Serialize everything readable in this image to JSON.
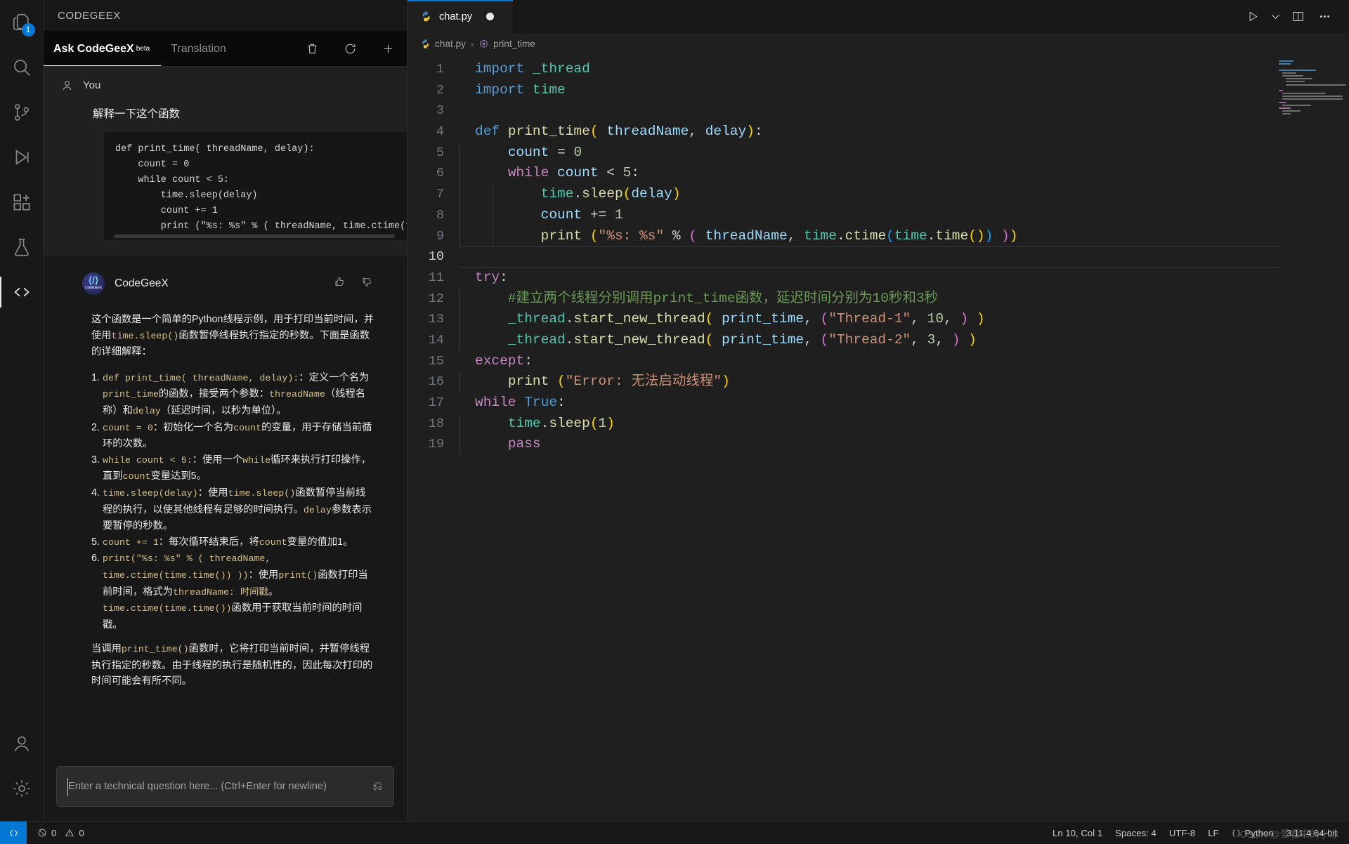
{
  "activitybar": {
    "items": [
      {
        "name": "explorer",
        "icon": "files-icon",
        "badge": "1",
        "active": false
      },
      {
        "name": "search",
        "icon": "search-icon",
        "badge": "",
        "active": false
      },
      {
        "name": "source-control",
        "icon": "source-control-icon",
        "badge": "",
        "active": false
      },
      {
        "name": "run-debug",
        "icon": "run-debug-icon",
        "badge": "",
        "active": false
      },
      {
        "name": "extensions",
        "icon": "extensions-icon",
        "badge": "",
        "active": false
      },
      {
        "name": "testing",
        "icon": "beaker-icon",
        "badge": "",
        "active": false
      },
      {
        "name": "codegeex",
        "icon": "code-brackets-icon",
        "badge": "",
        "active": true
      }
    ],
    "bottom": [
      {
        "name": "accounts",
        "icon": "account-icon"
      },
      {
        "name": "settings",
        "icon": "gear-icon"
      }
    ]
  },
  "sidepanel": {
    "title": "CODEGEEX",
    "tabs": [
      {
        "label": "Ask CodeGeeX",
        "sup": "beta",
        "active": true
      },
      {
        "label": "Translation",
        "sup": "",
        "active": false
      }
    ],
    "actions": [
      {
        "name": "clear-chat-button",
        "icon": "trash-icon"
      },
      {
        "name": "history-button",
        "icon": "history-icon"
      },
      {
        "name": "new-chat-button",
        "icon": "plus-icon"
      }
    ],
    "user_message": {
      "author": "You",
      "text": "解释一下这个函数",
      "code": "def print_time( threadName, delay):\n    count = 0\n    while count < 5:\n        time.sleep(delay)\n        count += 1\n        print (\"%s: %s\" % ( threadName, time.ctime(time.t"
    },
    "bot_message": {
      "author": "CodeGeeX",
      "intro_a": "这个函数是一个简单的Python线程示例，用于打印当前时间，并使用",
      "intro_code": "time.sleep()",
      "intro_b": "函数暂停线程执行指定的秒数。下面是函数的详细解释：",
      "items": [
        {
          "code": "def print_time( threadName, delay):",
          "text_a": "：定义一个名为",
          "code_b": "print_time",
          "text_b": "的函数，接受两个参数：",
          "code_c": "threadName",
          "text_c": "（线程名称）和",
          "code_d": "delay",
          "text_d": "（延迟时间，以秒为单位）。"
        },
        {
          "code": "count = 0",
          "text_a": "：初始化一个名为",
          "code_b": "count",
          "text_b": "的变量，用于存储当前循环的次数。"
        },
        {
          "code": "while count < 5:",
          "text_a": "：使用一个",
          "code_b": "while",
          "text_b": "循环来执行打印操作，直到",
          "code_c": "count",
          "text_c": "变量达到5。"
        },
        {
          "code": "time.sleep(delay)",
          "text_a": "：使用",
          "code_b": "time.sleep()",
          "text_b": "函数暂停当前线程的执行，以使其他线程有足够的时间执行。",
          "code_c": "delay",
          "text_c": "参数表示要暂停的秒数。"
        },
        {
          "code": "count += 1",
          "text_a": "：每次循环结束后，将",
          "code_b": "count",
          "text_b": "变量的值加1。"
        },
        {
          "code": "print(\"%s: %s\" % ( threadName, time.ctime(time.time()) ))",
          "text_a": "：使用",
          "code_b": "print()",
          "text_b": "函数打印当前时间，格式为",
          "code_c": "threadName: 时间戳",
          "text_c": "。",
          "code_d": "time.ctime(time.time())",
          "text_d": "函数用于获取当前时间的时间戳。"
        }
      ],
      "closing_a": "当调用",
      "closing_code": "print_time()",
      "closing_b": "函数时，它将打印当前时间，并暂停线程执行指定的秒数。由于线程的执行是随机性的，因此每次打印的时间可能会有所不同。",
      "thumbs_up": "thumbs-up-icon",
      "thumbs_down": "thumbs-down-icon"
    },
    "composer": {
      "placeholder": "Enter a technical question here... (Ctrl+Enter for newline)",
      "value": "",
      "submit_icon": "enter-key-icon"
    }
  },
  "editor": {
    "tab": {
      "label": "chat.py",
      "icon": "python-icon",
      "dirty": true
    },
    "tab_actions": [
      {
        "name": "run-button",
        "icon": "play-icon"
      },
      {
        "name": "run-dropdown",
        "icon": "chevron-down-icon"
      },
      {
        "name": "split-editor-button",
        "icon": "split-editor-icon"
      },
      {
        "name": "more-actions-button",
        "icon": "ellipsis-icon"
      }
    ],
    "breadcrumb": [
      {
        "label": "chat.py",
        "icon": "python-icon"
      },
      {
        "label": "print_time",
        "icon": "symbol-method-icon"
      }
    ],
    "current_line": 10,
    "lines": [
      {
        "n": 1,
        "tokens": [
          {
            "t": "kw2",
            "s": "import"
          },
          {
            "t": "op",
            "s": " "
          },
          {
            "t": "mod",
            "s": "_thread"
          }
        ]
      },
      {
        "n": 2,
        "tokens": [
          {
            "t": "kw2",
            "s": "import"
          },
          {
            "t": "op",
            "s": " "
          },
          {
            "t": "mod",
            "s": "time"
          }
        ]
      },
      {
        "n": 3,
        "tokens": []
      },
      {
        "n": 4,
        "tokens": [
          {
            "t": "kw2",
            "s": "def"
          },
          {
            "t": "op",
            "s": " "
          },
          {
            "t": "fn",
            "s": "print_time"
          },
          {
            "t": "p1",
            "s": "("
          },
          {
            "t": "op",
            "s": " "
          },
          {
            "t": "var",
            "s": "threadName"
          },
          {
            "t": "op",
            "s": ", "
          },
          {
            "t": "var",
            "s": "delay"
          },
          {
            "t": "p1",
            "s": ")"
          },
          {
            "t": "op",
            "s": ":"
          }
        ]
      },
      {
        "n": 5,
        "indent": 1,
        "tokens": [
          {
            "t": "op",
            "s": "    "
          },
          {
            "t": "var",
            "s": "count"
          },
          {
            "t": "op",
            "s": " = "
          },
          {
            "t": "num",
            "s": "0"
          }
        ]
      },
      {
        "n": 6,
        "indent": 1,
        "tokens": [
          {
            "t": "op",
            "s": "    "
          },
          {
            "t": "kw",
            "s": "while"
          },
          {
            "t": "op",
            "s": " "
          },
          {
            "t": "var",
            "s": "count"
          },
          {
            "t": "op",
            "s": " < "
          },
          {
            "t": "num",
            "s": "5"
          },
          {
            "t": "op",
            "s": ":"
          }
        ]
      },
      {
        "n": 7,
        "indent": 2,
        "tokens": [
          {
            "t": "op",
            "s": "        "
          },
          {
            "t": "mod",
            "s": "time"
          },
          {
            "t": "op",
            "s": "."
          },
          {
            "t": "fn",
            "s": "sleep"
          },
          {
            "t": "p1",
            "s": "("
          },
          {
            "t": "var",
            "s": "delay"
          },
          {
            "t": "p1",
            "s": ")"
          }
        ]
      },
      {
        "n": 8,
        "indent": 2,
        "tokens": [
          {
            "t": "op",
            "s": "        "
          },
          {
            "t": "var",
            "s": "count"
          },
          {
            "t": "op",
            "s": " += "
          },
          {
            "t": "num",
            "s": "1"
          }
        ]
      },
      {
        "n": 9,
        "indent": 2,
        "tokens": [
          {
            "t": "op",
            "s": "        "
          },
          {
            "t": "fn",
            "s": "print"
          },
          {
            "t": "op",
            "s": " "
          },
          {
            "t": "p1",
            "s": "("
          },
          {
            "t": "str",
            "s": "\"%s: %s\""
          },
          {
            "t": "op",
            "s": " % "
          },
          {
            "t": "p2",
            "s": "("
          },
          {
            "t": "op",
            "s": " "
          },
          {
            "t": "var",
            "s": "threadName"
          },
          {
            "t": "op",
            "s": ", "
          },
          {
            "t": "mod",
            "s": "time"
          },
          {
            "t": "op",
            "s": "."
          },
          {
            "t": "fn",
            "s": "ctime"
          },
          {
            "t": "p3",
            "s": "("
          },
          {
            "t": "mod",
            "s": "time"
          },
          {
            "t": "op",
            "s": "."
          },
          {
            "t": "fn",
            "s": "time"
          },
          {
            "t": "p1",
            "s": "()"
          },
          {
            "t": "p3",
            "s": ")"
          },
          {
            "t": "op",
            "s": " "
          },
          {
            "t": "p2",
            "s": ")"
          },
          {
            "t": "p1",
            "s": ")"
          }
        ]
      },
      {
        "n": 10,
        "tokens": []
      },
      {
        "n": 11,
        "tokens": [
          {
            "t": "kw",
            "s": "try"
          },
          {
            "t": "op",
            "s": ":"
          }
        ]
      },
      {
        "n": 12,
        "indent": 1,
        "tokens": [
          {
            "t": "op",
            "s": "    "
          },
          {
            "t": "com",
            "s": "#建立两个线程分别调用print_time函数，延迟时间分别为10秒和3秒"
          }
        ]
      },
      {
        "n": 13,
        "indent": 1,
        "tokens": [
          {
            "t": "op",
            "s": "    "
          },
          {
            "t": "mod",
            "s": "_thread"
          },
          {
            "t": "op",
            "s": "."
          },
          {
            "t": "fn",
            "s": "start_new_thread"
          },
          {
            "t": "p1",
            "s": "("
          },
          {
            "t": "op",
            "s": " "
          },
          {
            "t": "var",
            "s": "print_time"
          },
          {
            "t": "op",
            "s": ", "
          },
          {
            "t": "p2",
            "s": "("
          },
          {
            "t": "str",
            "s": "\"Thread-1\""
          },
          {
            "t": "op",
            "s": ", "
          },
          {
            "t": "num",
            "s": "10"
          },
          {
            "t": "op",
            "s": ", "
          },
          {
            "t": "p2",
            "s": ")"
          },
          {
            "t": "op",
            "s": " "
          },
          {
            "t": "p1",
            "s": ")"
          }
        ]
      },
      {
        "n": 14,
        "indent": 1,
        "tokens": [
          {
            "t": "op",
            "s": "    "
          },
          {
            "t": "mod",
            "s": "_thread"
          },
          {
            "t": "op",
            "s": "."
          },
          {
            "t": "fn",
            "s": "start_new_thread"
          },
          {
            "t": "p1",
            "s": "("
          },
          {
            "t": "op",
            "s": " "
          },
          {
            "t": "var",
            "s": "print_time"
          },
          {
            "t": "op",
            "s": ", "
          },
          {
            "t": "p2",
            "s": "("
          },
          {
            "t": "str",
            "s": "\"Thread-2\""
          },
          {
            "t": "op",
            "s": ", "
          },
          {
            "t": "num",
            "s": "3"
          },
          {
            "t": "op",
            "s": ", "
          },
          {
            "t": "p2",
            "s": ")"
          },
          {
            "t": "op",
            "s": " "
          },
          {
            "t": "p1",
            "s": ")"
          }
        ]
      },
      {
        "n": 15,
        "tokens": [
          {
            "t": "kw",
            "s": "except"
          },
          {
            "t": "op",
            "s": ":"
          }
        ]
      },
      {
        "n": 16,
        "indent": 1,
        "tokens": [
          {
            "t": "op",
            "s": "    "
          },
          {
            "t": "fn",
            "s": "print"
          },
          {
            "t": "op",
            "s": " "
          },
          {
            "t": "p1",
            "s": "("
          },
          {
            "t": "str",
            "s": "\"Error: 无法启动线程\""
          },
          {
            "t": "p1",
            "s": ")"
          }
        ]
      },
      {
        "n": 17,
        "tokens": [
          {
            "t": "kw",
            "s": "while"
          },
          {
            "t": "op",
            "s": " "
          },
          {
            "t": "kw2",
            "s": "True"
          },
          {
            "t": "op",
            "s": ":"
          }
        ]
      },
      {
        "n": 18,
        "indent": 1,
        "tokens": [
          {
            "t": "op",
            "s": "    "
          },
          {
            "t": "mod",
            "s": "time"
          },
          {
            "t": "op",
            "s": "."
          },
          {
            "t": "fn",
            "s": "sleep"
          },
          {
            "t": "p1",
            "s": "("
          },
          {
            "t": "num",
            "s": "1"
          },
          {
            "t": "p1",
            "s": ")"
          }
        ]
      },
      {
        "n": 19,
        "indent": 1,
        "tokens": [
          {
            "t": "op",
            "s": "    "
          },
          {
            "t": "kw",
            "s": "pass"
          }
        ]
      }
    ]
  },
  "statusbar": {
    "remote_icon": "remote-window-icon",
    "errors": "0",
    "warnings": "0",
    "position": "Ln 10, Col 1",
    "indentation": "Spaces: 4",
    "encoding": "UTF-8",
    "eol": "LF",
    "language": "Python",
    "interpreter": "3.11.4 64-bit"
  },
  "watermark": "CSDN @爱看书的小冰",
  "colors": {
    "accent": "#0078d4",
    "editor_bg": "#1f1f1f",
    "panel_bg": "#181818",
    "badge": "#0078d4"
  }
}
